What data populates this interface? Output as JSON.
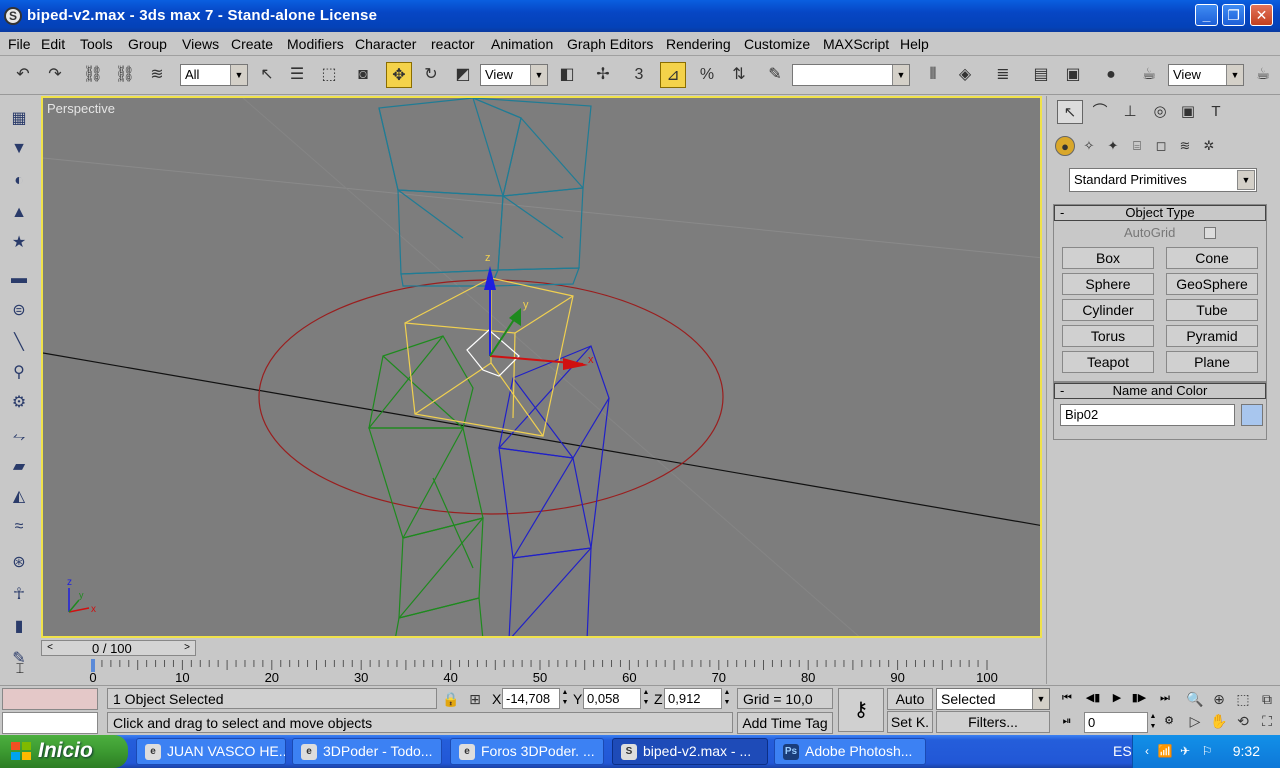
{
  "window": {
    "title": "biped-v2.max - 3ds max 7  - Stand-alone License",
    "minimize": "_",
    "maximize": "❐",
    "close": "✕"
  },
  "menu": [
    "File",
    "Edit",
    "Tools",
    "Group",
    "Views",
    "Create",
    "Modifiers",
    "Character",
    "reactor",
    "Animation",
    "Graph Editors",
    "Rendering",
    "Customize",
    "MAXScript",
    "Help"
  ],
  "toolbar": {
    "selection_filter": "All",
    "ref_coord": "View",
    "named_selection": "",
    "render_view": "View",
    "snap_label": "3",
    "percent_label": "%"
  },
  "viewport": {
    "label": "Perspective",
    "gizmo_x": "x",
    "gizmo_y": "y",
    "gizmo_z": "z",
    "axis_tripod": {
      "x": "x",
      "y": "y",
      "z": "z"
    }
  },
  "command_panel": {
    "category": "Standard Primitives",
    "object_type": {
      "title": "Object Type",
      "autogrid": "AutoGrid",
      "buttons": [
        "Box",
        "Cone",
        "Sphere",
        "GeoSphere",
        "Cylinder",
        "Tube",
        "Torus",
        "Pyramid",
        "Teapot",
        "Plane"
      ]
    },
    "name_and_color": {
      "title": "Name and Color",
      "name": "Bip02",
      "color": "#a8c6ee"
    }
  },
  "time_slider": {
    "label": "0 / 100",
    "prev": "<",
    "next": ">"
  },
  "track_bar": {
    "ticks": [
      "0",
      "10",
      "20",
      "30",
      "40",
      "50",
      "60",
      "70",
      "80",
      "90",
      "100"
    ]
  },
  "status": {
    "selection": "1 Object Selected",
    "prompt": "Click and drag to select and move objects",
    "x_label": "X",
    "x_value": "-14,708",
    "y_label": "Y",
    "y_value": "0,058",
    "z_label": "Z",
    "z_value": "0,912",
    "grid": "Grid = 10,0",
    "add_time_tag": "Add Time Tag",
    "auto_key": "Auto",
    "set_key": "Set K.",
    "key_mode": "Selected",
    "filters": "Filters...",
    "frame": "0"
  },
  "taskbar": {
    "start": "Inicio",
    "tasks": [
      "JUAN VASCO HE...",
      "3DPoder - Todo...",
      "Foros 3DPoder. ...",
      "biped-v2.max - ...",
      "Adobe Photosh..."
    ],
    "language": "ES",
    "clock": "9:32"
  },
  "colors": {
    "viewport_bg": "#7d7d7d",
    "active_border": "#f0e24a",
    "titlebar": "#0646c4",
    "taskbar": "#245edb",
    "start": "#3c9a31"
  }
}
